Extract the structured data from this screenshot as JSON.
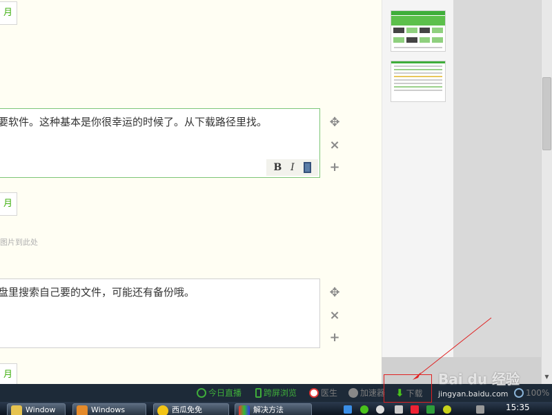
{
  "editor": {
    "partial_button_label": "月",
    "step1_text": "要软件。这种基本是你很幸运的时候了。从下载路径里找。",
    "step2_text": "盘里搜索自己要的文件，可能还有备份哦。",
    "drop_hint": "图片到此处",
    "format_bold": "B",
    "format_italic": "I",
    "controls": {
      "move_symbol": "✥",
      "delete_symbol": "×",
      "add_symbol": "+"
    }
  },
  "statusbar": {
    "items": [
      {
        "label": "今日直播",
        "icon": "play-circle-icon",
        "color": "#3fae3a"
      },
      {
        "label": "跨屏浏览",
        "icon": "phone-icon",
        "color": "#3fae3a"
      },
      {
        "label": "医生",
        "icon": "medical-cross-icon",
        "color": "#7c7c7c"
      },
      {
        "label": "加速器",
        "icon": "rocket-icon",
        "color": "#7c7c7c"
      },
      {
        "label": "下载",
        "icon": "download-arrow-icon",
        "color": "#7c7c7c"
      },
      {
        "label": "100%",
        "icon": "zoom-icon",
        "color": "#7c7c7c"
      }
    ]
  },
  "taskbar": {
    "tasks": [
      {
        "label": "Window"
      },
      {
        "label": "Windows"
      },
      {
        "label": "西瓜免免"
      },
      {
        "label": "解决方法"
      }
    ],
    "clock": "15:35"
  },
  "watermark": {
    "brand": "Bai du 经验",
    "url": "jingyan.baidu.com"
  }
}
